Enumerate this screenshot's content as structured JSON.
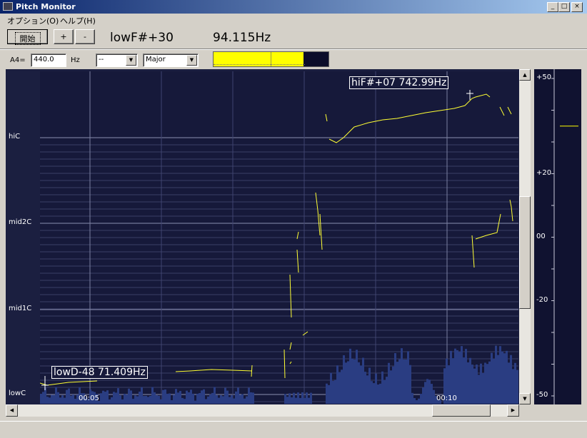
{
  "window": {
    "title": "Pitch Monitor",
    "minimize": "_",
    "maximize": "□",
    "close": "×"
  },
  "menu": [
    {
      "label": "オプション(O)"
    },
    {
      "label": "ヘルプ(H)"
    }
  ],
  "toolbar": {
    "start_label": "開始",
    "plus_label": "+",
    "minus_label": "-",
    "note_reading": "lowF#+30",
    "freq_reading": "94.115Hz"
  },
  "settings": {
    "a4_label": "A4=",
    "a4_value": "440.0",
    "hz_label": "Hz",
    "key_value": "--",
    "scale_value": "Major",
    "level_fraction": 0.78
  },
  "colors": {
    "panel_bg": "#16193a",
    "pitch": "#ffff33",
    "volume": "#2a3d82",
    "meter": "#ffff00"
  },
  "pitch_axis": [
    "hiC",
    "mid2C",
    "mid1C",
    "lowC"
  ],
  "time_axis": [
    "00:05",
    "00:10"
  ],
  "annotations": {
    "max": "hiF#+07  742.99Hz",
    "min": "lowD-48  71.409Hz"
  },
  "cents_axis": [
    "+50",
    "+20",
    "00",
    "-20",
    "-50"
  ],
  "cents_current": 35
}
